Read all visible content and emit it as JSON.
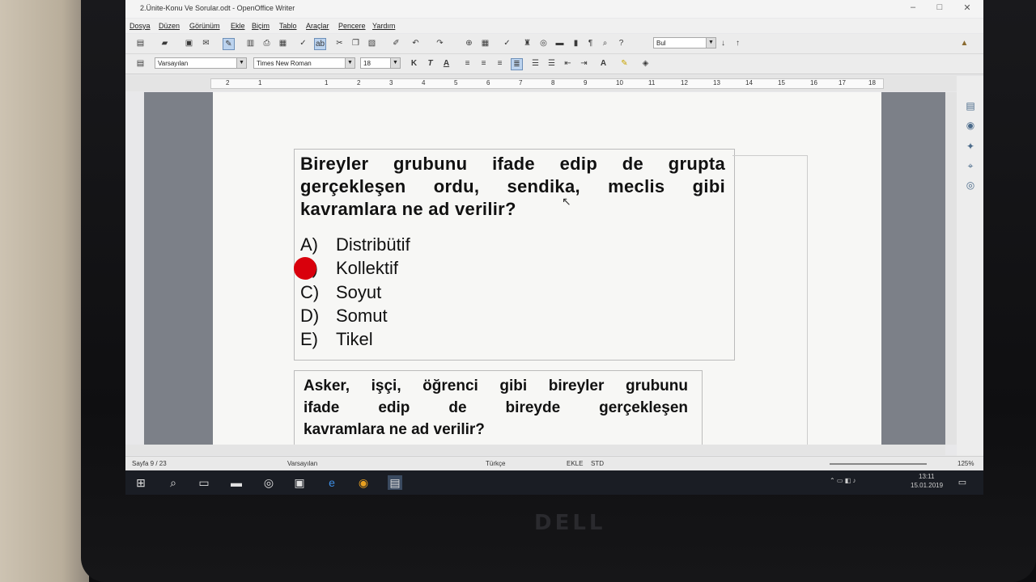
{
  "window": {
    "title": "2.Ünite-Konu Ve Sorular.odt - OpenOffice Writer"
  },
  "menu": [
    "Dosya",
    "Düzen",
    "Görünüm",
    "Ekle",
    "Biçim",
    "Tablo",
    "Araçlar",
    "Pencere",
    "Yardım"
  ],
  "toolbar": {
    "find_value": "Bul",
    "style_value": "Varsayılan",
    "font_value": "Times New Roman",
    "size_value": "18",
    "bold": "K",
    "italic": "T",
    "underline": "A"
  },
  "ruler": [
    "2",
    "1",
    "1",
    "2",
    "3",
    "4",
    "5",
    "6",
    "7",
    "8",
    "9",
    "10",
    "11",
    "12",
    "13",
    "14",
    "15",
    "16",
    "17",
    "18"
  ],
  "document": {
    "question1": {
      "line1": "Bireyler grubunu ifade edip de grupta",
      "line2": "gerçekleşen ordu, sendika, meclis gibi",
      "line3": "kavramlara ne ad verilir?"
    },
    "options": [
      {
        "letter": "A)",
        "text": "Distribütif",
        "selected": false
      },
      {
        "letter": "B)",
        "text": "Kollektif",
        "selected": true
      },
      {
        "letter": "C)",
        "text": "Soyut",
        "selected": false
      },
      {
        "letter": "D)",
        "text": "Somut",
        "selected": false
      },
      {
        "letter": "E)",
        "text": "Tikel",
        "selected": false
      }
    ],
    "question2": {
      "line1": "Asker, işçi, öğrenci gibi bireyler grubunu",
      "line2": "ifade edip de bireyde gerçekleşen",
      "line3": "kavramlara ne ad verilir?"
    },
    "selection_color": "#d9000c"
  },
  "status": {
    "page": "Sayfa 9 / 23",
    "style": "Varsayılan",
    "language": "Türkçe",
    "insert": "EKLE",
    "mode": "STD",
    "zoom": "125%"
  },
  "taskbar": {
    "time": "13:11",
    "date": "15.01.2019"
  },
  "brand": "DELL"
}
